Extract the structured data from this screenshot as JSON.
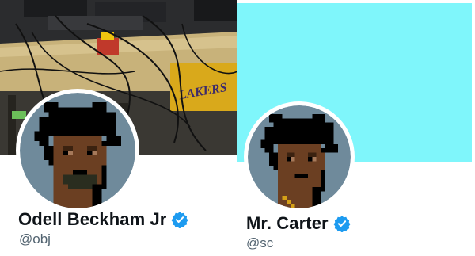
{
  "profiles": [
    {
      "display_name": "Odell Beckham Jr",
      "handle": "@obj",
      "verified": true,
      "banner": {
        "kind": "photo",
        "sign_text": "LAKERS"
      },
      "avatar_icon": "cryptopunk-avatar-icon"
    },
    {
      "display_name": "Mr. Carter",
      "handle": "@sc",
      "verified": true,
      "banner": {
        "kind": "solid",
        "color": "#7ff6fb"
      },
      "avatar_icon": "cryptopunk-avatar-icon"
    }
  ],
  "colors": {
    "verified_badge": "#1d9bf0",
    "name_text": "#0f1419",
    "handle_text": "#536471",
    "avatar_bg": "#6f8a9b",
    "skin": "#6b3f22"
  }
}
